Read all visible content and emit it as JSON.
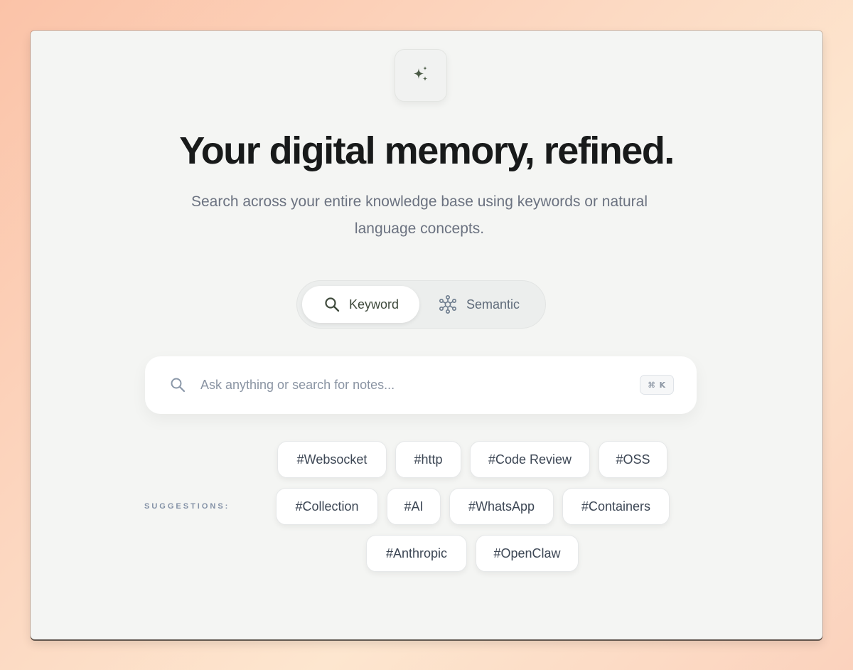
{
  "hero": {
    "icon": "sparkles-icon",
    "title": "Your digital memory, refined.",
    "subtitle": "Search across your entire knowledge base using keywords or natural language concepts."
  },
  "mode_toggle": {
    "selected": "Keyword",
    "options": [
      {
        "label": "Keyword",
        "icon": "search-icon"
      },
      {
        "label": "Semantic",
        "icon": "network-icon"
      }
    ]
  },
  "search": {
    "placeholder": "Ask anything or search for notes...",
    "value": "",
    "shortcut": "⌘ K"
  },
  "suggestions": {
    "label": "SUGGESTIONS:",
    "tags": [
      "#Websocket",
      "#http",
      "#Code Review",
      "#OSS",
      "#Collection",
      "#AI",
      "#WhatsApp",
      "#Containers",
      "#Anthropic",
      "#OpenClaw"
    ]
  },
  "colors": {
    "accent": "#4a5a45",
    "card_bg": "#f4f5f3",
    "text_primary": "#181a1a",
    "text_muted": "#6b7280"
  }
}
